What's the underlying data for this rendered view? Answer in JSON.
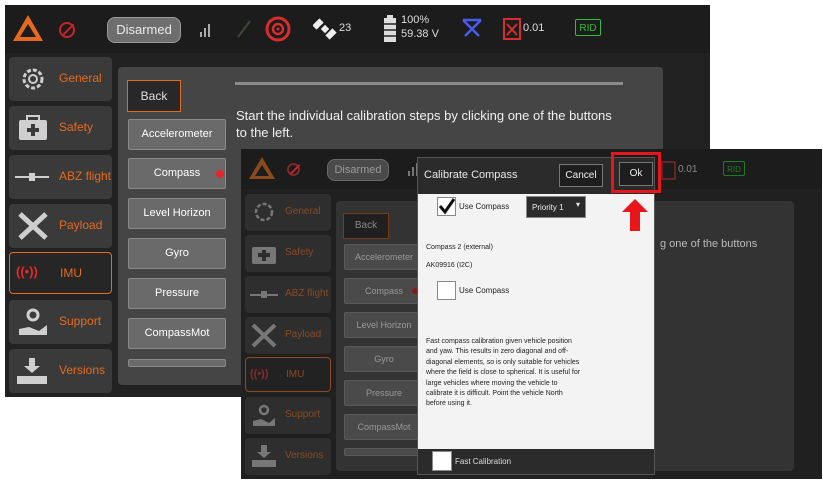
{
  "back_window": {
    "toolbar": {
      "arm_status": "Disarmed",
      "satellite_count": "23",
      "battery_percent": "100%",
      "battery_voltage": "59.38 V",
      "hdop": "0.01",
      "rid_label": "RID"
    },
    "sidebar": [
      {
        "label": "General",
        "icon": "gear-icon"
      },
      {
        "label": "Safety",
        "icon": "first-aid-icon"
      },
      {
        "label": "ABZ flight",
        "icon": "aircraft-icon"
      },
      {
        "label": "Payload",
        "icon": "tools-icon"
      },
      {
        "label": "IMU",
        "icon": "imu-icon"
      },
      {
        "label": "Support",
        "icon": "support-icon"
      },
      {
        "label": "Versions",
        "icon": "versions-icon"
      }
    ],
    "calibration": {
      "back_label": "Back",
      "instruction": "Start the individual calibration steps by clicking one of the buttons to the left.",
      "instruction_line1": "Start the individual calibration steps by clicking one of the buttons",
      "instruction_line2": "to the left.",
      "buttons": [
        "Accelerometer",
        "Compass",
        "Level Horizon",
        "Gyro",
        "Pressure",
        "CompassMot"
      ]
    }
  },
  "front_window": {
    "toolbar": {
      "arm_status": "Disarmed",
      "hdop": "0.01",
      "rid_label": "RID"
    },
    "sidebar": [
      "General",
      "Safety",
      "ABZ flight",
      "Payload",
      "IMU",
      "Support",
      "Versions"
    ],
    "calibration": {
      "back_label": "Back",
      "buttons": [
        "Accelerometer",
        "Compass",
        "Level Horizon",
        "Gyro",
        "Pressure",
        "CompassMot"
      ],
      "instruction_fragment": "g one of the buttons"
    },
    "dialog": {
      "title": "Calibrate Compass",
      "cancel_label": "Cancel",
      "ok_label": "Ok",
      "use_compass_1_label": "Use Compass",
      "use_compass_1_checked": true,
      "priority_value": "Priority 1",
      "compass2_heading": "Compass 2 (external)",
      "compass2_device": "AK09916 (I2C)",
      "use_compass_2_label": "Use Compass",
      "use_compass_2_checked": false,
      "description": "Fast compass calibration given vehicle position and yaw. This results in zero diagonal and off-diagonal elements, so is only suitable for vehicles where the field is close to spherical. It is useful for large vehicles where moving the vehicle to calibrate it is difficult. Point the vehicle North before using it.",
      "description_lines": [
        "Fast compass calibration given vehicle position",
        "and yaw. This results in zero diagonal and off-",
        "diagonal elements, so is only suitable for vehicles",
        "where the field is close to spherical. It is useful for",
        "large vehicles where moving the vehicle to",
        "calibrate it is difficult. Point the vehicle North",
        "before using it."
      ],
      "fast_calibration_label": "Fast Calibration",
      "fast_calibration_checked": false
    }
  },
  "colors": {
    "accent": "#e66a1e",
    "highlight": "#e8151b",
    "status_red": "#c8232b",
    "rid_green": "#2fbf3a",
    "link_blue": "#3a5adf"
  }
}
